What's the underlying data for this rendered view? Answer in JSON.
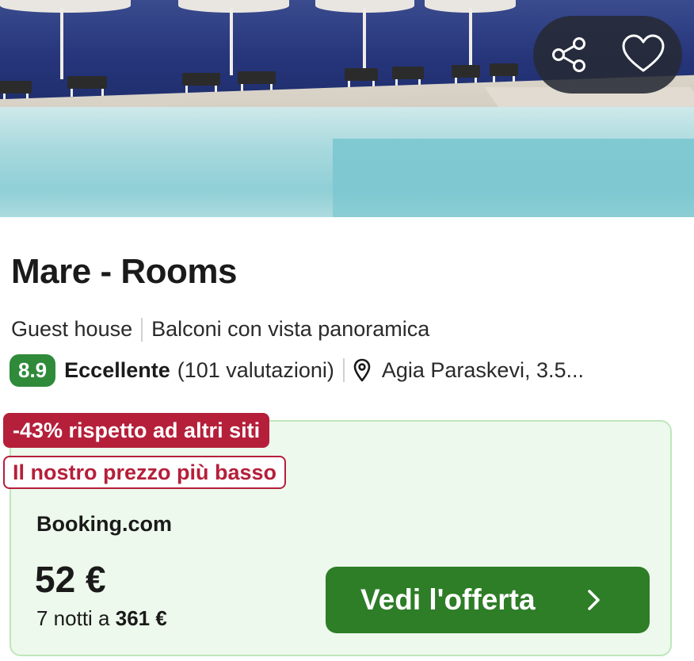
{
  "hero": {
    "share_icon": "share-icon",
    "favorite_icon": "heart-icon"
  },
  "listing": {
    "title": "Mare - Rooms",
    "property_type": "Guest house",
    "feature": "Balconi con vista panoramica",
    "rating_score": "8.9",
    "rating_label": "Eccellente",
    "reviews_count": "(101 valutazioni)",
    "location": "Agia Paraskevi, 3.5..."
  },
  "deal": {
    "discount_badge": "-43% rispetto ad altri siti",
    "lowest_price_badge": "Il nostro prezzo più basso",
    "provider": "Booking.com",
    "price": "52 €",
    "stay_prefix": "7 notti a ",
    "stay_total": "361 €",
    "cta_label": "Vedi l'offerta"
  },
  "colors": {
    "score_green": "#2f8a3a",
    "cta_green": "#2e7d27",
    "badge_red": "#b51f3a",
    "card_bg": "#edf9ec"
  }
}
